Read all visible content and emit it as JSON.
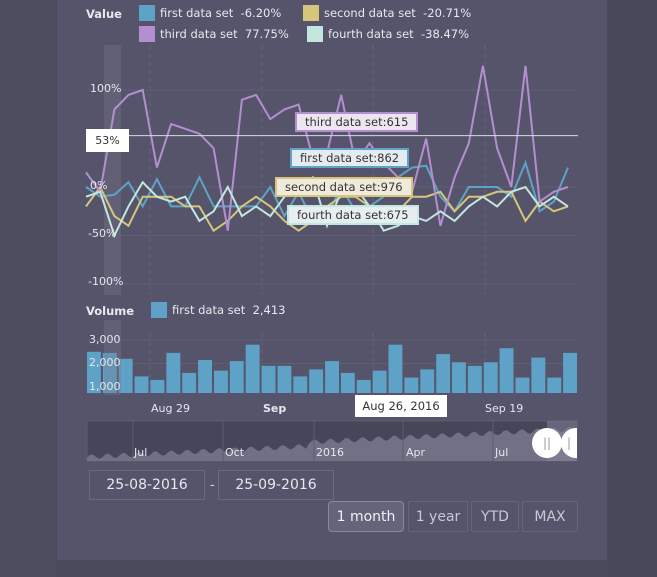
{
  "chart_data": [
    {
      "type": "line",
      "title": "Value",
      "ylabel": "",
      "xlabel": "",
      "ylim": [
        -100,
        120
      ],
      "yticks": [
        "100%",
        "0%",
        "-50%",
        "-100%"
      ],
      "ytick_values": [
        100,
        0,
        -50,
        -100
      ],
      "grid": true,
      "legend_position": "top",
      "crosshair": {
        "label": "53%",
        "value": 53
      },
      "series": [
        {
          "name": "first data set",
          "legend_value": "-6.20%",
          "color": "#5ea3c7",
          "values": [
            0,
            -10,
            -8,
            5,
            -20,
            8,
            -20,
            -20,
            10,
            -20,
            -20,
            -20,
            -20,
            0,
            -30,
            -5,
            -35,
            -30,
            0,
            -25,
            -20,
            -10,
            10,
            20,
            22,
            -10,
            -25,
            0,
            0,
            0,
            -10,
            25,
            -25,
            -15,
            20
          ]
        },
        {
          "name": "second data set",
          "legend_value": "-20.71%",
          "color": "#d8c57c",
          "values": [
            -20,
            0,
            -30,
            -40,
            -10,
            -10,
            -10,
            -20,
            -20,
            -45,
            -35,
            -20,
            -10,
            -20,
            -35,
            -45,
            -35,
            -20,
            -10,
            -10,
            -20,
            -30,
            -25,
            -10,
            -10,
            -5,
            -25,
            -10,
            -10,
            -5,
            -5,
            -35,
            -15,
            -25,
            -20
          ]
        },
        {
          "name": "third data set",
          "legend_value": "77.75%",
          "color": "#b48fd0",
          "values": [
            15,
            -5,
            80,
            95,
            100,
            20,
            65,
            60,
            55,
            40,
            -45,
            90,
            95,
            70,
            80,
            85,
            30,
            35,
            95,
            25,
            45,
            25,
            10,
            -5,
            50,
            -40,
            10,
            45,
            125,
            40,
            0,
            125,
            -15,
            -5,
            0
          ]
        },
        {
          "name": "fourth data set",
          "legend_value": "-38.47%",
          "color": "#c4e6df",
          "values": [
            -10,
            -5,
            -50,
            -20,
            5,
            -10,
            -15,
            -10,
            -35,
            -25,
            0,
            -30,
            -20,
            -30,
            -10,
            0,
            10,
            -40,
            -5,
            0,
            -20,
            -45,
            -40,
            -30,
            -35,
            -25,
            -35,
            -20,
            -10,
            -20,
            -5,
            0,
            -20,
            -10,
            -20
          ]
        }
      ]
    },
    {
      "type": "bar",
      "title": "Volume",
      "ylim": [
        750,
        3200
      ],
      "yticks": [
        "3,000",
        "2,000",
        "1,000"
      ],
      "ytick_values": [
        3000,
        2000,
        1000
      ],
      "series": [
        {
          "name": "first data set",
          "legend_value": "2,413",
          "color": "#5ea3c7",
          "values": [
            2500,
            2450,
            2200,
            1450,
            1300,
            2450,
            1600,
            2150,
            1700,
            2100,
            2800,
            1900,
            1900,
            1450,
            1750,
            2100,
            1600,
            1300,
            1700,
            2800,
            1400,
            1750,
            2400,
            2050,
            1900,
            2050,
            2650,
            1400,
            2250,
            1400,
            2450
          ]
        }
      ]
    }
  ],
  "x_axis": {
    "ticks": [
      "Aug 29",
      "Sep",
      "Sep 19"
    ],
    "bold": [
      false,
      true,
      false
    ]
  },
  "tooltips": [
    {
      "series": "third data set",
      "text": "third data set:615"
    },
    {
      "series": "first data set",
      "text": "first data set:862"
    },
    {
      "series": "second data set",
      "text": "second data set:976"
    },
    {
      "series": "fourth data set",
      "text": "fourth data set:675"
    }
  ],
  "date_tooltip": "Aug 26, 2016",
  "navigator": {
    "labels": [
      "Jul",
      "Oct",
      "2016",
      "Apr",
      "Jul"
    ],
    "left_handle_icon": "grip-icon",
    "right_handle_icon": "grip-icon"
  },
  "range_selector": {
    "from": "25-08-2016",
    "separator": "-",
    "to": "25-09-2016",
    "buttons": [
      "1 month",
      "1 year",
      "YTD",
      "MAX"
    ],
    "active": "1 month"
  }
}
